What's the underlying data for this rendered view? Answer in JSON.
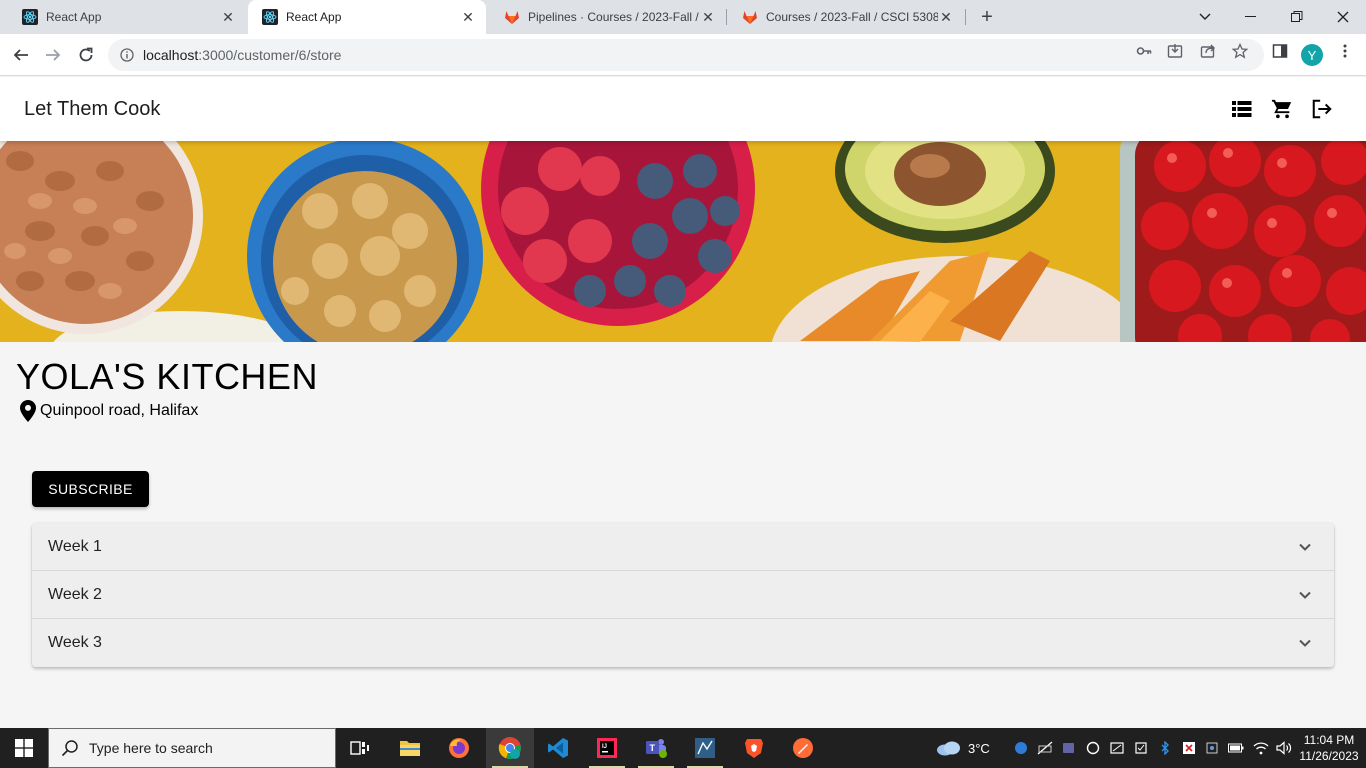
{
  "browser": {
    "tabs": [
      {
        "title": "React App",
        "active": false
      },
      {
        "title": "React App",
        "active": true
      },
      {
        "title": "Pipelines · Courses / 2023-Fall / C",
        "active": false
      },
      {
        "title": "Courses / 2023-Fall / CSCI 5308",
        "active": false
      }
    ],
    "address": {
      "host": "localhost",
      "path": ":3000/customer/6/store"
    },
    "profile_initial": "Y"
  },
  "app": {
    "brand": "Let Them Cook",
    "header_icons": [
      "list-icon",
      "cart-icon",
      "logout-icon"
    ]
  },
  "store": {
    "name": "YOLA'S KITCHEN",
    "location": "Quinpool road, Halifax",
    "subscribe_label": "SUBSCRIBE",
    "weeks": [
      "Week 1",
      "Week 2",
      "Week 3"
    ]
  },
  "taskbar": {
    "search_placeholder": "Type here to search",
    "weather": "3°C",
    "time": "11:04 PM",
    "date": "11/26/2023"
  },
  "colors": {
    "primary_button": "#000000",
    "accordion_bg": "#eeeeee",
    "taskbar_bg": "#202020",
    "profile": "#12a4a8"
  }
}
